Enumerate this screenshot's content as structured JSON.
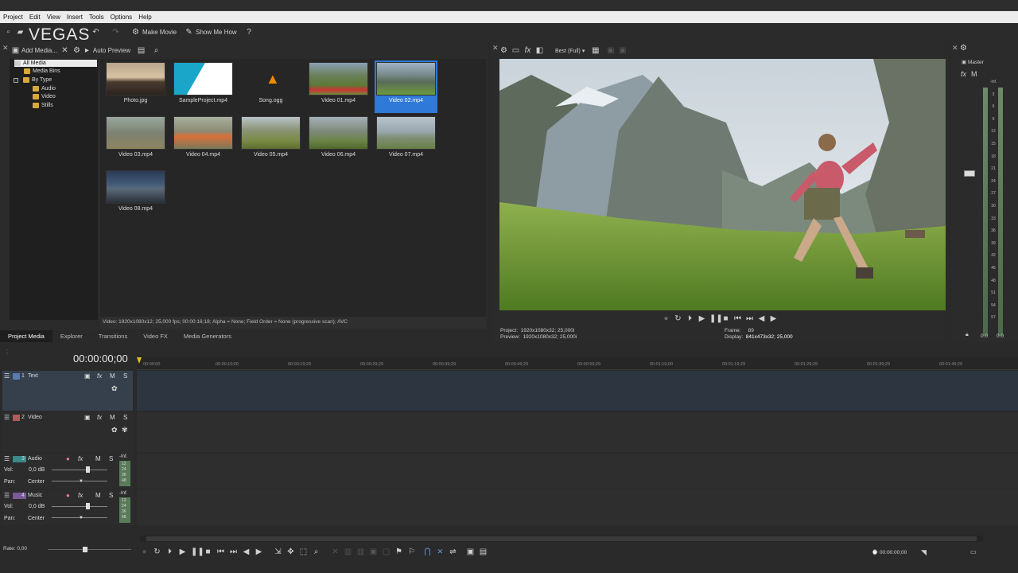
{
  "app": {
    "logo": "VEGAS"
  },
  "menu": [
    "Project",
    "Edit",
    "View",
    "Insert",
    "Tools",
    "Options",
    "Help"
  ],
  "toolbar": {
    "make_movie": "Make Movie",
    "show_me_how": "Show Me How"
  },
  "media": {
    "add_media": "Add Media...",
    "auto_preview": "Auto Preview",
    "tree": {
      "all_media": "All Media",
      "media_bins": "Media Bins",
      "by_type": "By Type",
      "audio": "Audio",
      "video": "Video",
      "stills": "Stills"
    },
    "items": [
      {
        "name": "Photo.jpg"
      },
      {
        "name": "SampleProject.mp4"
      },
      {
        "name": "Song.ogg"
      },
      {
        "name": "Video 01.mp4"
      },
      {
        "name": "Video 02.mp4",
        "selected": true
      },
      {
        "name": "Video 03.mp4"
      },
      {
        "name": "Video 04.mp4"
      },
      {
        "name": "Video 05.mp4"
      },
      {
        "name": "Video 06.mp4"
      },
      {
        "name": "Video 07.mp4"
      },
      {
        "name": "Video 08.mp4"
      }
    ],
    "status": "Video: 1920x1080x12; 25,000 fps; 00:00:16;18; Alpha = None; Field Order = None (progressive scan); AVC",
    "tabs": [
      "Project Media",
      "Explorer",
      "Transitions",
      "Video FX",
      "Media Generators"
    ]
  },
  "preview": {
    "quality": "Best (Full)",
    "project_label": "Project:",
    "project_value": "1920x1080x32; 25,000i",
    "preview_label": "Preview:",
    "preview_value": "1920x1080x32; 25,000i",
    "frame_label": "Frame:",
    "frame_value": "89",
    "display_label": "Display:",
    "display_value": "841x473x32; 25,000"
  },
  "master": {
    "label": "Master",
    "scale": [
      "-Inf.",
      "3",
      "6",
      "9",
      "12",
      "15",
      "18",
      "21",
      "24",
      "27",
      "30",
      "33",
      "36",
      "39",
      "42",
      "45",
      "48",
      "51",
      "54",
      "57"
    ],
    "left_value": "0.0",
    "right_value": "0.0"
  },
  "timeline": {
    "timecode": "00:00:00;00",
    "ruler": [
      "00:00:00",
      "00:00:10;00",
      "00:00:19;29",
      "00:00:29;29",
      "00:00:39;29",
      "00:00:49;29",
      "00:00:59;29",
      "00:01:10;00",
      "00:01:19;29",
      "00:01:29;29",
      "00:01:39;29",
      "00:01:49;29"
    ],
    "tracks": [
      {
        "num": "1",
        "name": "Text"
      },
      {
        "num": "2",
        "name": "Video"
      },
      {
        "num": "3",
        "name": "Audio",
        "vol_label": "Vol:",
        "vol": "0,0 dB",
        "pan_label": "Pan:",
        "pan": "Center"
      },
      {
        "num": "4",
        "name": "Music",
        "vol_label": "Vol:",
        "vol": "0,0 dB",
        "pan_label": "Pan:",
        "pan": "Center"
      }
    ],
    "track_meter_top": "-Inf.",
    "track_meter_scale": [
      "12",
      "24",
      "36",
      "48"
    ],
    "rate": "Rate: 0,00",
    "end_time": "00:00:00;00"
  },
  "track_controls": {
    "mute": "M",
    "solo": "S"
  },
  "colors": {
    "accent": "#2f79d8",
    "folder": "#d6a93a"
  }
}
